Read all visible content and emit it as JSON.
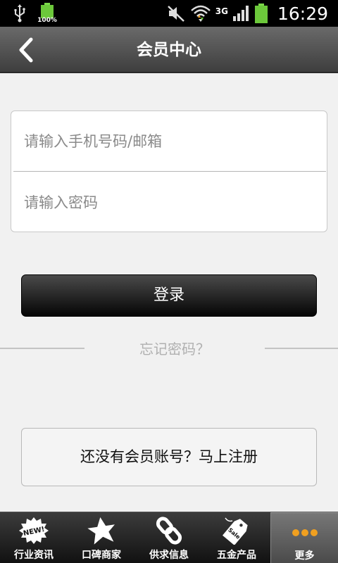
{
  "status_bar": {
    "battery_small_pct": "100%",
    "network": "3G",
    "time": "16:29"
  },
  "header": {
    "title": "会员中心"
  },
  "form": {
    "phone_placeholder": "请输入手机号码/邮箱",
    "password_placeholder": "请输入密码"
  },
  "login_label": "登录",
  "forgot_label": "忘记密码？",
  "register_label": "还没有会员账号？马上注册",
  "tabs": [
    {
      "label": "行业资讯",
      "icon": "new-badge-icon"
    },
    {
      "label": "口碑商家",
      "icon": "star-icon"
    },
    {
      "label": "供求信息",
      "icon": "chain-link-icon"
    },
    {
      "label": "五金产品",
      "icon": "sale-tag-icon"
    },
    {
      "label": "更多",
      "icon": "more-dots-icon"
    }
  ],
  "colors": {
    "accent_orange": "#f0a020",
    "battery_green": "#6cc83b"
  }
}
